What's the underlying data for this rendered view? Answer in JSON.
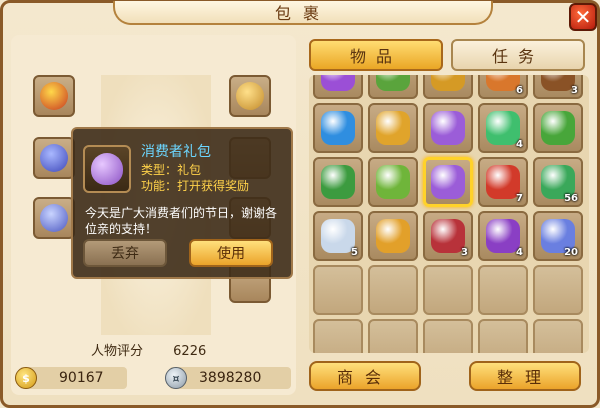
{
  "window": {
    "title": "包裹"
  },
  "close": {
    "label": "✕"
  },
  "tabs": [
    {
      "label": "物品",
      "active": true
    },
    {
      "label": "任务",
      "active": false
    }
  ],
  "inventory": {
    "partial_row": [
      {
        "icon": "purple-crystal-icon",
        "color": "#9b4fd6"
      },
      {
        "icon": "green-cloth-icon",
        "color": "#5aa43c"
      },
      {
        "icon": "gold-chest-icon",
        "color": "#d59a25"
      },
      {
        "icon": "orange-bag-icon",
        "color": "#d9772c",
        "qty": "6"
      },
      {
        "icon": "brown-claw-icon",
        "color": "#8a5226",
        "qty": "3"
      }
    ],
    "rows": [
      [
        {
          "icon": "blue-orb-icon",
          "color": "#2f8ee0"
        },
        {
          "icon": "gold-coins-icon",
          "color": "#e0a42b"
        },
        {
          "icon": "purple-gift-bag-icon",
          "color": "#9b5dd8"
        },
        {
          "icon": "green-potion-icon",
          "color": "#3fbf6e",
          "qty": "4"
        },
        {
          "icon": "green-box-icon",
          "color": "#48a63a"
        }
      ],
      [
        {
          "icon": "green-chest-icon",
          "color": "#3c9b3f"
        },
        {
          "icon": "green-beans-icon",
          "color": "#6fb53a"
        },
        {
          "icon": "purple-gift-bag-icon",
          "color": "#9b5dd8",
          "selected": true
        },
        {
          "icon": "red-firecracker-icon",
          "color": "#d23a2a",
          "qty": "7"
        },
        {
          "icon": "green-dragon-icon",
          "color": "#3aa85a",
          "qty": "56"
        }
      ],
      [
        {
          "icon": "white-pearl-icon",
          "color": "#c9d8ea",
          "qty": "5"
        },
        {
          "icon": "gold-gourd-icon",
          "color": "#e2a02a"
        },
        {
          "icon": "red-book-icon",
          "color": "#b8323a",
          "qty": "3"
        },
        {
          "icon": "purple-crystal-ball-icon",
          "color": "#8a3fc4",
          "qty": "4"
        },
        {
          "icon": "rainbow-stone-icon",
          "color": "#6a7fe0",
          "qty": "20"
        }
      ],
      [
        {},
        {},
        {},
        {},
        {}
      ],
      [
        {},
        {},
        {},
        {},
        {}
      ]
    ]
  },
  "buttons": {
    "shop": "商会",
    "sort": "整理"
  },
  "character": {
    "score_label": "人物评分",
    "score_value": "6226"
  },
  "currency": {
    "gold": "90167",
    "silver": "3898280"
  },
  "tooltip": {
    "name": "消费者礼包",
    "type_line": "类型：礼包",
    "function_line": "功能：打开获得奖励",
    "description": "今天是广大消费者们的节日，谢谢各位亲的支持！",
    "discard_label": "丢弃",
    "use_label": "使用"
  }
}
